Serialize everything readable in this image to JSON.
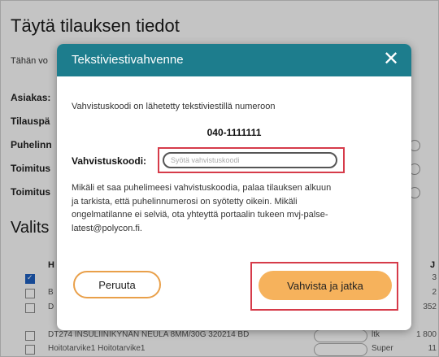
{
  "page": {
    "title": "Täytä tilauksen tiedot",
    "intro": "Tähän vo",
    "fields": [
      "Asiakas:",
      "Tilauspä",
      "Puhelinn",
      "Toimitus",
      "Toimitus"
    ],
    "section_title": "Valits",
    "table_header": "H",
    "table_header_right": "J",
    "rows": [
      {
        "name": "",
        "checked": true,
        "unit": "",
        "value": "3"
      },
      {
        "name": "B",
        "checked": false,
        "unit": "",
        "value": "2"
      },
      {
        "name": "D",
        "checked": false,
        "unit": "",
        "value": "352"
      },
      {
        "name": "DT274 INSULIINIKYNÄN NEULA 8MM/30G 320214 BD",
        "checked": false,
        "unit": "ltk",
        "value": "1 800"
      },
      {
        "name": "Hoitotarvike1 Hoitotarvike1",
        "checked": false,
        "unit": "Super",
        "value": "11"
      }
    ]
  },
  "modal": {
    "title": "Tekstiviestivahvenne",
    "close_symbol": "✕",
    "info": "Vahvistuskoodi on lähetetty tekstiviestillä numeroon",
    "phone": "040-1111111",
    "code_label": "Vahvistuskoodi:",
    "code_placeholder": "Syötä vahvistuskoodi",
    "notice_lines": [
      "Mikäli et saa puhelimeesi vahvistuskoodia, palaa tilauksen alkuun",
      "ja tarkista, että puhelinnumerosi on syötetty oikein. Mikäli",
      "ongelmatilanne ei selviä, ota yhteyttä portaalin tukeen mvj-palse-",
      "latest@polycon.fi."
    ],
    "cancel_label": "Peruuta",
    "confirm_label": "Vahvista ja jatka"
  }
}
